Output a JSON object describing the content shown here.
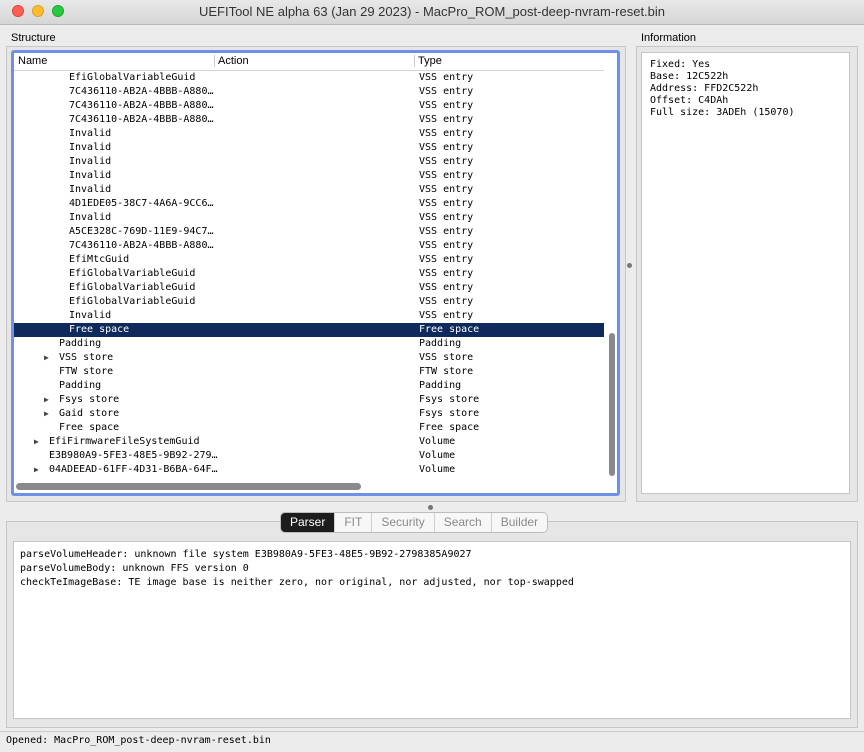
{
  "window": {
    "title": "UEFITool NE alpha 63 (Jan 29 2023) - MacPro_ROM_post-deep-nvram-reset.bin"
  },
  "structure": {
    "label": "Structure",
    "columns": {
      "name": "Name",
      "action": "Action",
      "type": "Type"
    },
    "rows": [
      {
        "name": "EfiGlobalVariableGuid",
        "type": "VSS entry"
      },
      {
        "name": "7C436110-AB2A-4BBB-A880…",
        "type": "VSS entry"
      },
      {
        "name": "7C436110-AB2A-4BBB-A880…",
        "type": "VSS entry"
      },
      {
        "name": "7C436110-AB2A-4BBB-A880…",
        "type": "VSS entry"
      },
      {
        "name": "Invalid",
        "type": "VSS entry"
      },
      {
        "name": "Invalid",
        "type": "VSS entry"
      },
      {
        "name": "Invalid",
        "type": "VSS entry"
      },
      {
        "name": "Invalid",
        "type": "VSS entry"
      },
      {
        "name": "Invalid",
        "type": "VSS entry"
      },
      {
        "name": "4D1EDE05-38C7-4A6A-9CC6…",
        "type": "VSS entry"
      },
      {
        "name": "Invalid",
        "type": "VSS entry"
      },
      {
        "name": "A5CE328C-769D-11E9-94C7…",
        "type": "VSS entry"
      },
      {
        "name": "7C436110-AB2A-4BBB-A880…",
        "type": "VSS entry"
      },
      {
        "name": "EfiMtcGuid",
        "type": "VSS entry"
      },
      {
        "name": "EfiGlobalVariableGuid",
        "type": "VSS entry"
      },
      {
        "name": "EfiGlobalVariableGuid",
        "type": "VSS entry"
      },
      {
        "name": "EfiGlobalVariableGuid",
        "type": "VSS entry"
      },
      {
        "name": "Invalid",
        "type": "VSS entry"
      },
      {
        "name": "Free space",
        "type": "Free space"
      },
      {
        "name": "Padding",
        "type": "Padding"
      },
      {
        "name": "VSS store",
        "type": "VSS store"
      },
      {
        "name": "FTW store",
        "type": "FTW store"
      },
      {
        "name": "Padding",
        "type": "Padding"
      },
      {
        "name": "Fsys store",
        "type": "Fsys store"
      },
      {
        "name": "Gaid store",
        "type": "Fsys store"
      },
      {
        "name": "Free space",
        "type": "Free space"
      },
      {
        "name": "EfiFirmwareFileSystemGuid",
        "type": "Volume"
      },
      {
        "name": "E3B980A9-5FE3-48E5-9B92-279…",
        "type": "Volume"
      },
      {
        "name": "04ADEEAD-61FF-4D31-B6BA-64F…",
        "type": "Volume"
      }
    ]
  },
  "information": {
    "label": "Information",
    "lines": [
      "Fixed: Yes",
      "Base: 12C522h",
      "Address: FFD2C522h",
      "Offset: C4DAh",
      "Full size: 3ADEh (15070)"
    ]
  },
  "tabs": [
    "Parser",
    "FIT",
    "Security",
    "Search",
    "Builder"
  ],
  "messages": [
    "parseVolumeHeader: unknown file system E3B980A9-5FE3-48E5-9B92-2798385A9027",
    "parseVolumeBody: unknown FFS version 0",
    "checkTeImageBase: TE image base is neither zero, nor original, nor adjusted, nor top-swapped"
  ],
  "status": {
    "text": "Opened: MacPro_ROM_post-deep-nvram-reset.bin"
  }
}
